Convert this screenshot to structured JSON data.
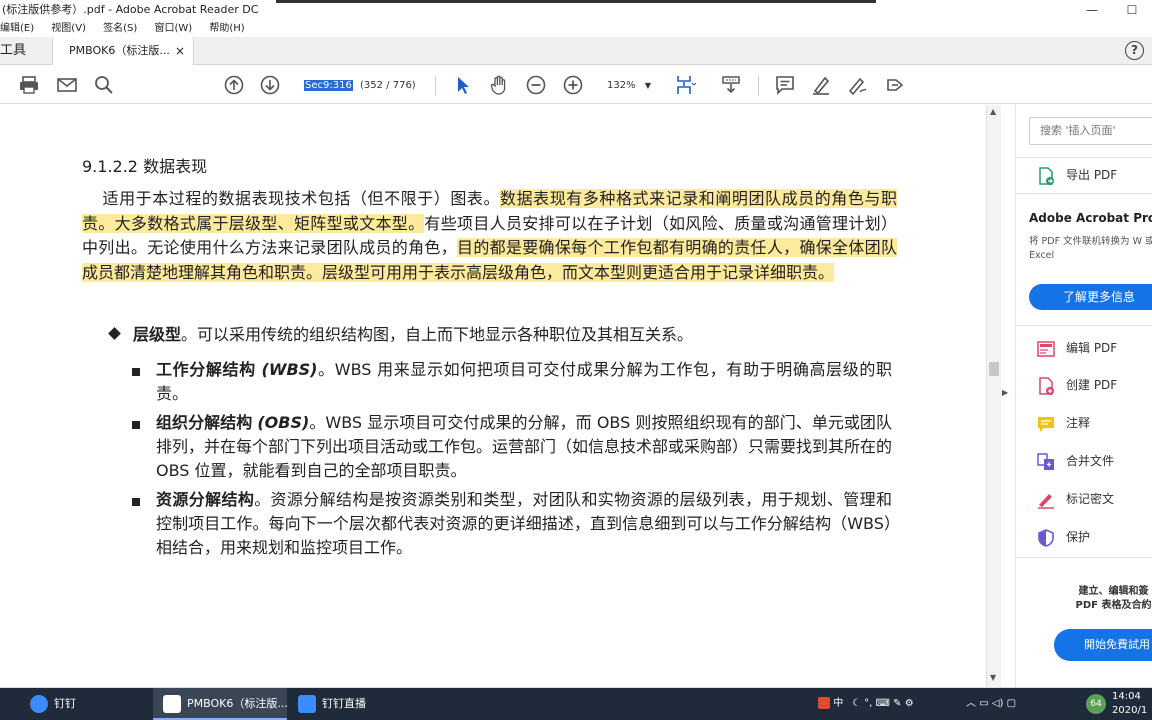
{
  "window": {
    "title": "(标注版供参考）.pdf - Adobe Acrobat Reader DC",
    "minimize": "—",
    "maximize": "☐"
  },
  "menu": [
    "编辑(E)",
    "视图(V)",
    "签名(S)",
    "窗口(W)",
    "帮助(H)"
  ],
  "tabs": {
    "tools": "工具",
    "document": "PMBOK6（标注版...",
    "close": "×",
    "help": "?"
  },
  "toolbar": {
    "page_label": "Sec9:316",
    "page_count": "(352 / 776)",
    "zoom": "132%",
    "zoom_dropdown": "▼"
  },
  "document": {
    "heading": "9.1.2.2 数据表现",
    "paragraph": {
      "p1": "适用于本过程的数据表现技术包括（但不限于）图表。",
      "h1": "数据表现有多种格式来记录和阐明团队成员的角色与职责。大多数格式属于层级型、矩阵型或文本型。",
      "p2": "有些项目人员安排可以在子计划（如风险、质量或沟通管理计划）中列出。无论使用什么方法来记录团队成员的角色，",
      "h2": "目的都是要确保每个工作包都有明确的责任人，确保全体团队成员都清楚地理解其角色和职责。层级型可用用于表示高层级角色，而文本型则更适合用于记录详细职责。"
    },
    "bullet": {
      "label": "层级型",
      "text": "。可以采用传统的组织结构图，自上而下地显示各种职位及其相互关系。"
    },
    "subbullets": [
      {
        "label": "工作分解结构",
        "abbr": "(WBS)",
        "text": "。WBS 用来显示如何把项目可交付成果分解为工作包，有助于明确高层级的职责。"
      },
      {
        "label": "组织分解结构",
        "abbr": "(OBS)",
        "text": "。WBS 显示项目可交付成果的分解，而 OBS 则按照组织现有的部门、单元或团队排列，并在每个部门下列出项目活动或工作包。运营部门（如信息技术部或采购部）只需要找到其所在的 OBS 位置，就能看到自己的全部项目职责。"
      },
      {
        "label": "资源分解结构",
        "abbr": "",
        "text": "。资源分解结构是按资源类别和类型，对团队和实物资源的层级列表，用于规划、管理和控制项目工作。每向下一个层次都代表对资源的更详细描述，直到信息细到可以与工作分解结构（WBS）相结合，用来规划和监控项目工作。"
      }
    ]
  },
  "scrollbar": {
    "up": "▲",
    "down": "▼",
    "collapse": "▶"
  },
  "right_pane": {
    "search_placeholder": "搜索 '插入页面'",
    "export_pdf": "导出 PDF",
    "promo_title": "Adobe Acrobat Pro D",
    "promo_text": "将 PDF 文件联机转换为 W 或 Excel",
    "promo_button": "了解更多信息",
    "tools": [
      "编辑 PDF",
      "创建 PDF",
      "注释",
      "合并文件",
      "标记密文",
      "保护"
    ],
    "bottom_text": "建立、编辑和簽 PDF 表格及合約",
    "bottom_button": "開始免費試用"
  },
  "taskbar": {
    "items": [
      "钉钉",
      "PMBOK6（标注版...",
      "钉钉直播"
    ],
    "tray_ime": "中",
    "tray_badge": "64",
    "time": "14:04",
    "date": "2020/1"
  },
  "colors": {
    "highlight": "#fdea9c",
    "accent": "#1473e6",
    "taskbar": "#1f2a3a"
  }
}
